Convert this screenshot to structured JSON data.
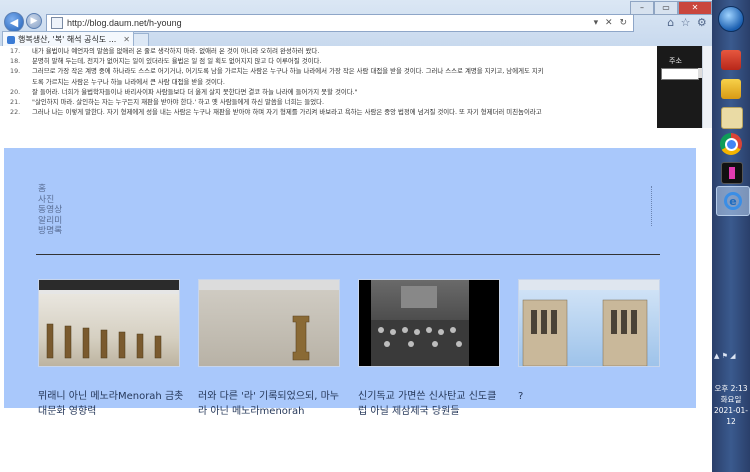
{
  "browser": {
    "url": "http://blog.daum.net/h-young",
    "tab_title": "행복생산, '복' 해석 공식도 ...",
    "address_buttons": "▾ ✕ ↻",
    "window_controls": {
      "minimize": "–",
      "maximize": "▭",
      "close": "✕"
    },
    "back_icon": "back-arrow-icon",
    "forward_icon": "forward-arrow-icon"
  },
  "background_page": {
    "verses": [
      {
        "num": "17.",
        "text": "내가 율법이나 예언자의 말씀을 없애러 온 줄로 생각하지 마라. 없애러 온 것이 아니라 오히려 완성하러 왔다."
      },
      {
        "num": "18.",
        "text": "분명히 말해 두는데, 천지가 없어지는 일이 있더라도 율법은 일 점 일 획도 없어지지 않고 다 이루어질 것이다."
      },
      {
        "num": "19.",
        "text": "그러므로 가장 작은 계명 중에 하나라도 스스로 어기거나, 어기도록 남을 가르치는 사람은 누구나 하늘 나라에서 가장 작은 사람 대접을 받을 것이다. 그러나 스스로 계명을 지키고, 남에게도 지키"
      },
      {
        "num": "",
        "text": "도록 가르치는 사람은 누구나 하늘 나라에서 큰 사람 대접을 받을 것이다."
      },
      {
        "num": "20.",
        "text": "잘 들어라. 너희가 율법학자들이나 바리사이파 사람들보다 더 옳게 살지 못한다면 결코 하늘 나라에 들어가지 못할 것이다.\""
      },
      {
        "num": "21.",
        "text": "\"살인하지 마라. 살인하는 자는 누구든지 재판을 받아야 한다.' 하고 옛 사람들에게 하신 말씀을 너희는 들었다."
      },
      {
        "num": "22.",
        "text": "그러나 나는 이렇게 말한다. 자기 형제에게 성을 내는 사람은 누구나 재판을 받아야 하며 자기 형제를 가리켜 바보라고 욕하는 사람은 중앙 법정에 넘겨질 것이다. 또 자기 형제더러 미친놈이라고"
      }
    ],
    "side_panel_label": "주소"
  },
  "blog": {
    "nav": [
      "홈",
      "사진",
      "동영상",
      "알리미",
      "방명록"
    ],
    "posts": [
      {
        "caption": "뮈래니 아닌 메노라Menorah 금촛대문화 영향력"
      },
      {
        "caption": "러와 다른 '라' 기록되었으되, 마누라 아닌 메노라menorah"
      },
      {
        "caption": "신기독교 가면쓴 신사탄교 신도클럽 아닐 제삼제국 당원들"
      },
      {
        "caption": "?"
      }
    ]
  },
  "taskbar": {
    "clock_time": "오후 2:13",
    "clock_day": "화요일",
    "clock_date": "2021-01-12"
  },
  "colors": {
    "overlay_bg": "#a9c8fb",
    "nav_link": "#5a6f96",
    "caption": "#26385a",
    "taskbar": "#2a3f6a"
  }
}
